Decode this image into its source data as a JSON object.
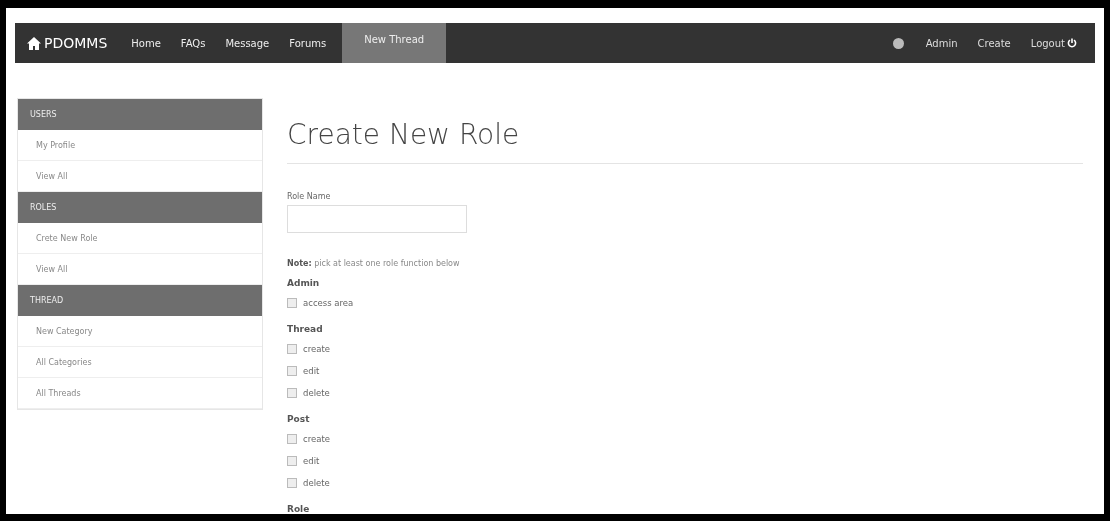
{
  "navbar": {
    "brand": "PDOMMS",
    "links": [
      {
        "label": "Home",
        "selected": false
      },
      {
        "label": "FAQs",
        "selected": false
      },
      {
        "label": "Message",
        "selected": false
      },
      {
        "label": "Forums",
        "selected": false
      },
      {
        "label": "New Thread",
        "selected": true
      }
    ],
    "right_links": [
      {
        "label": "Admin",
        "kind": "link"
      },
      {
        "label": "Create",
        "kind": "link"
      },
      {
        "label": "Logout",
        "kind": "logout"
      }
    ]
  },
  "sidebar": {
    "sections": [
      {
        "title": "USERS",
        "items": [
          "My Profile",
          "View All"
        ]
      },
      {
        "title": "ROLES",
        "items": [
          "Crete New Role",
          "View All"
        ]
      },
      {
        "title": "THREAD",
        "items": [
          "New Category",
          "All Categories",
          "All Threads"
        ]
      }
    ]
  },
  "form": {
    "title": "Create New Role",
    "role_name": {
      "label": "Role Name"
    },
    "note": "**Note:** pick at least one role function below",
    "groups": [
      {
        "title": "Admin",
        "options": [
          {
            "label": "access area",
            "checked": false
          }
        ]
      },
      {
        "title": "Thread",
        "options": [
          {
            "label": "create",
            "checked": false
          },
          {
            "label": "edit",
            "checked": false
          },
          {
            "label": "delete",
            "checked": false
          }
        ]
      },
      {
        "title": "Post",
        "options": [
          {
            "label": "create",
            "checked": false
          },
          {
            "label": "edit",
            "checked": false
          },
          {
            "label": "delete",
            "checked": false
          }
        ]
      },
      {
        "title": "Role"
      }
    ]
  }
}
